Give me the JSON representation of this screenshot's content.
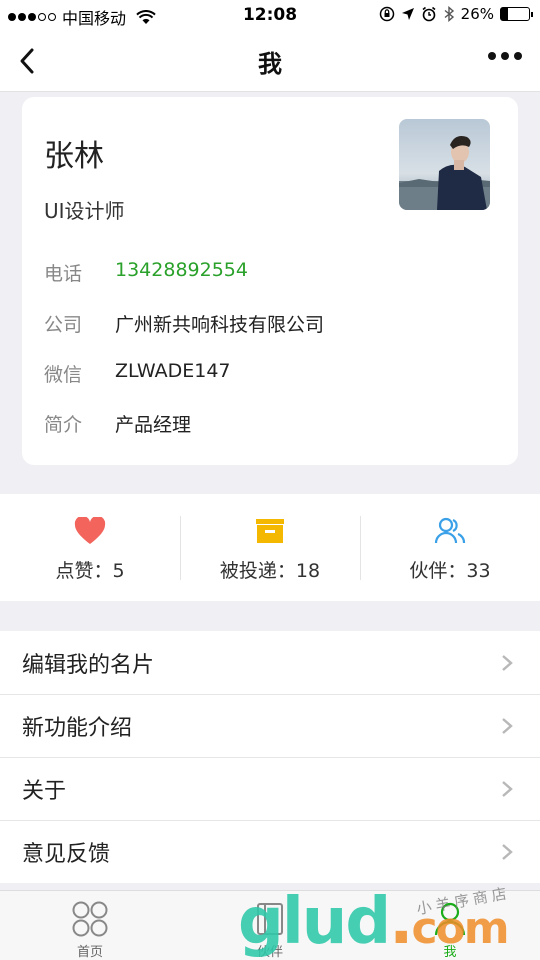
{
  "status_bar": {
    "carrier": "中国移动",
    "time": "12:08",
    "battery": "26%",
    "battery_level": 0.26
  },
  "nav": {
    "title": "我",
    "back_icon": "chevron-left-icon",
    "more_icon": "more-dots-icon"
  },
  "profile": {
    "name": "张林",
    "job_title": "UI设计师",
    "fields": [
      {
        "label": "电话",
        "value": "13428892554"
      },
      {
        "label": "公司",
        "value": "广州新共响科技有限公司"
      },
      {
        "label": "微信",
        "value": "ZLWADE147"
      },
      {
        "label": "简介",
        "value": "产品经理"
      }
    ]
  },
  "stats": [
    {
      "label": "点赞：5",
      "icon": "heart-icon",
      "color": "#f2645c"
    },
    {
      "label": "被投递：18",
      "icon": "box-icon",
      "color": "#f5b800"
    },
    {
      "label": "伙伴：33",
      "icon": "partners-icon",
      "color": "#3aa0e8"
    }
  ],
  "menu": [
    {
      "label": "编辑我的名片"
    },
    {
      "label": "新功能介绍"
    },
    {
      "label": "关于"
    },
    {
      "label": "意见反馈"
    }
  ],
  "tabs": [
    {
      "label": "首页",
      "icon": "grid-icon"
    },
    {
      "label": "伙伴",
      "icon": "book-icon"
    },
    {
      "label": "我",
      "icon": "person-icon",
      "active": true
    }
  ],
  "watermark": {
    "main": "glud",
    "dot": ".",
    "com": "com",
    "sub": "小羊序商店"
  },
  "colors": {
    "accent_green": "#1aad19",
    "phone_green": "#2aa12a",
    "background": "#efeff4"
  }
}
